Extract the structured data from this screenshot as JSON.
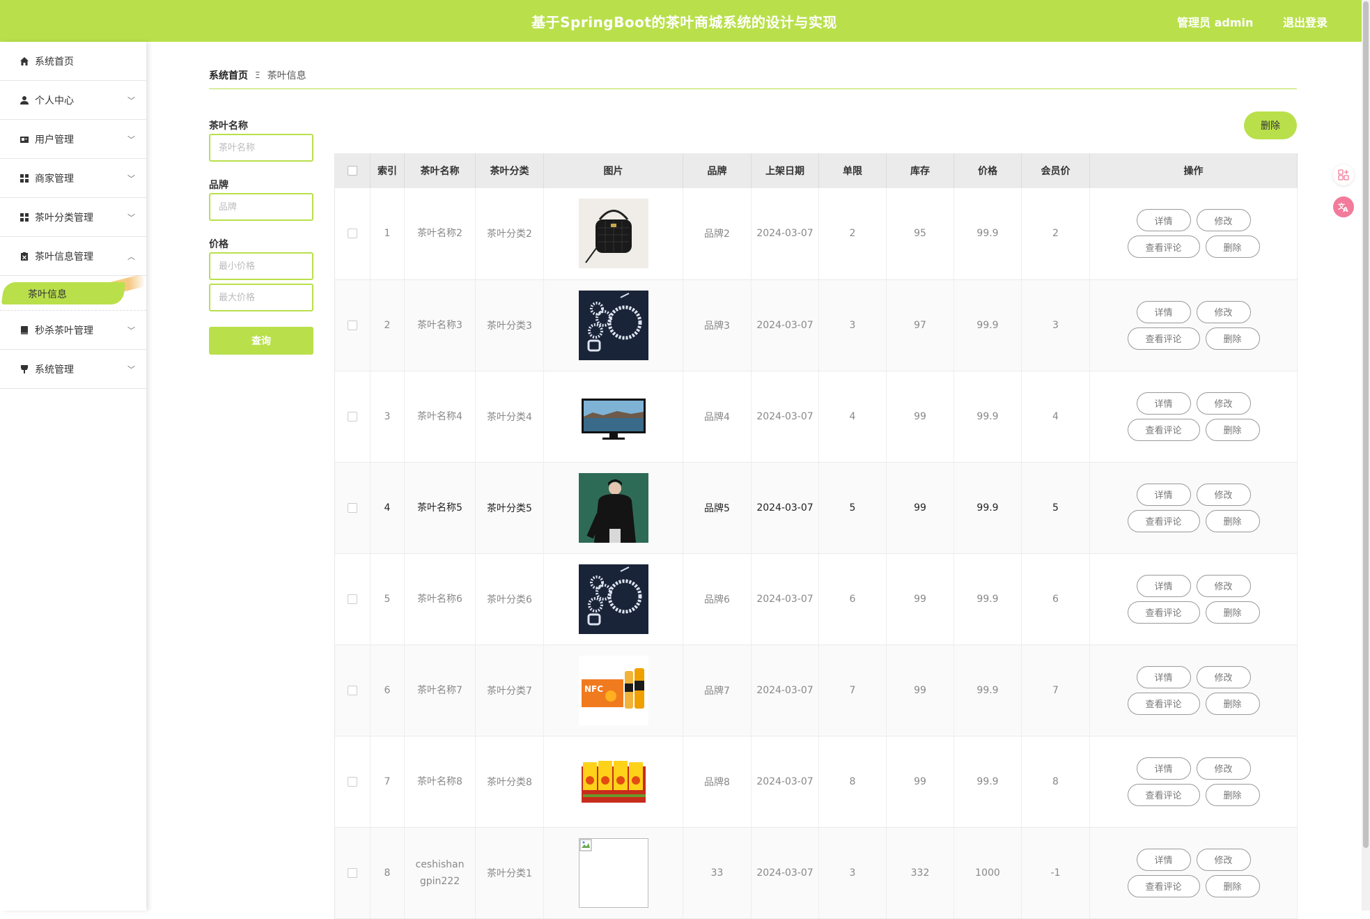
{
  "header": {
    "title": "基于SpringBoot的茶叶商城系统的设计与实现",
    "user": "管理员 admin",
    "logout": "退出登录"
  },
  "sidebar": {
    "items": [
      {
        "label": "系统首页",
        "icon": "home-icon"
      },
      {
        "label": "个人中心",
        "icon": "user-icon"
      },
      {
        "label": "用户管理",
        "icon": "id-card-icon"
      },
      {
        "label": "商家管理",
        "icon": "grid-icon"
      },
      {
        "label": "茶叶分类管理",
        "icon": "grid-icon"
      },
      {
        "label": "茶叶信息管理",
        "icon": "clipboard-icon"
      },
      {
        "label": "秒杀茶叶管理",
        "icon": "book-icon"
      },
      {
        "label": "系统管理",
        "icon": "brush-icon"
      }
    ],
    "sub_active": "茶叶信息"
  },
  "breadcrumb": {
    "home": "系统首页",
    "separator": "Ξ",
    "current": "茶叶信息"
  },
  "search": {
    "name_label": "茶叶名称",
    "name_placeholder": "茶叶名称",
    "brand_label": "品牌",
    "brand_placeholder": "品牌",
    "price_label": "价格",
    "min_placeholder": "最小价格",
    "max_placeholder": "最大价格",
    "query": "查询"
  },
  "toolbar": {
    "delete": "删除"
  },
  "table": {
    "headers": [
      "索引",
      "茶叶名称",
      "茶叶分类",
      "图片",
      "品牌",
      "上架日期",
      "单限",
      "库存",
      "价格",
      "会员价",
      "操作"
    ],
    "actions": {
      "detail": "详情",
      "edit": "修改",
      "comments": "查看评论",
      "delete": "删除"
    },
    "rows": [
      {
        "index": "1",
        "name": "茶叶名称2",
        "category": "茶叶分类2",
        "image": "handbag",
        "brand": "品牌2",
        "date": "2024-03-07",
        "limit": "2",
        "stock": "95",
        "price": "99.9",
        "member_price": "2"
      },
      {
        "index": "2",
        "name": "茶叶名称3",
        "category": "茶叶分类3",
        "image": "jewelry",
        "brand": "品牌3",
        "date": "2024-03-07",
        "limit": "3",
        "stock": "97",
        "price": "99.9",
        "member_price": "3"
      },
      {
        "index": "3",
        "name": "茶叶名称4",
        "category": "茶叶分类4",
        "image": "monitor",
        "brand": "品牌4",
        "date": "2024-03-07",
        "limit": "4",
        "stock": "99",
        "price": "99.9",
        "member_price": "4"
      },
      {
        "index": "4",
        "name": "茶叶名称5",
        "category": "茶叶分类5",
        "image": "jacket",
        "brand": "品牌5",
        "date": "2024-03-07",
        "limit": "5",
        "stock": "99",
        "price": "99.9",
        "member_price": "5"
      },
      {
        "index": "5",
        "name": "茶叶名称6",
        "category": "茶叶分类6",
        "image": "jewelry",
        "brand": "品牌6",
        "date": "2024-03-07",
        "limit": "6",
        "stock": "99",
        "price": "99.9",
        "member_price": "6"
      },
      {
        "index": "6",
        "name": "茶叶名称7",
        "category": "茶叶分类7",
        "image": "juice-nfc",
        "brand": "品牌7",
        "date": "2024-03-07",
        "limit": "7",
        "stock": "99",
        "price": "99.9",
        "member_price": "7"
      },
      {
        "index": "7",
        "name": "茶叶名称8",
        "category": "茶叶分类8",
        "image": "juice-box",
        "brand": "品牌8",
        "date": "2024-03-07",
        "limit": "8",
        "stock": "99",
        "price": "99.9",
        "member_price": "8"
      },
      {
        "index": "8",
        "name": "ceshishangpin222",
        "category": "茶叶分类1",
        "image": "broken",
        "brand": "33",
        "date": "2024-03-07",
        "limit": "3",
        "stock": "332",
        "price": "1000",
        "member_price": "-1"
      }
    ]
  },
  "colors": {
    "accent": "#b9e04b"
  }
}
